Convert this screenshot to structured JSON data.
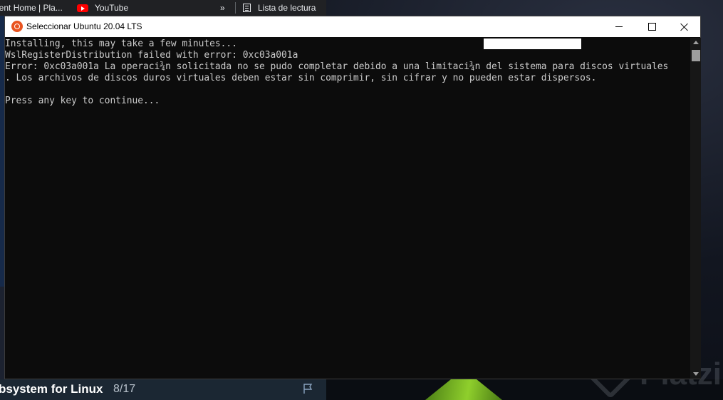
{
  "browser": {
    "bookmarks": [
      {
        "label": "dent Home | Pla..."
      },
      {
        "label": "YouTube",
        "icon": "youtube-icon"
      },
      {
        "label": "Lista de lectura",
        "icon": "reading-list-icon"
      }
    ],
    "more_label": "»"
  },
  "course": {
    "title": "bsystem for Linux",
    "progress": "8/17"
  },
  "watermark": "Platzi",
  "window": {
    "title": "Seleccionar Ubuntu 20.04 LTS",
    "icon": "ubuntu-icon"
  },
  "console": {
    "lines": [
      "Installing, this may take a few minutes...",
      "WslRegisterDistribution failed with error: 0xc03a001a",
      "Error: 0xc03a001a La operaci¾n solicitada no se pudo completar debido a una limitaci¾n del sistema para discos virtuales",
      ". Los archivos de discos duros virtuales deben estar sin comprimir, sin cifrar y no pueden estar dispersos.",
      "",
      "Press any key to continue..."
    ]
  },
  "colors": {
    "console_bg": "#0c0c0c",
    "console_text": "#cccccc",
    "titlebar_bg": "#ffffff",
    "ubuntu_orange": "#e95420",
    "youtube_red": "#ff0000"
  }
}
